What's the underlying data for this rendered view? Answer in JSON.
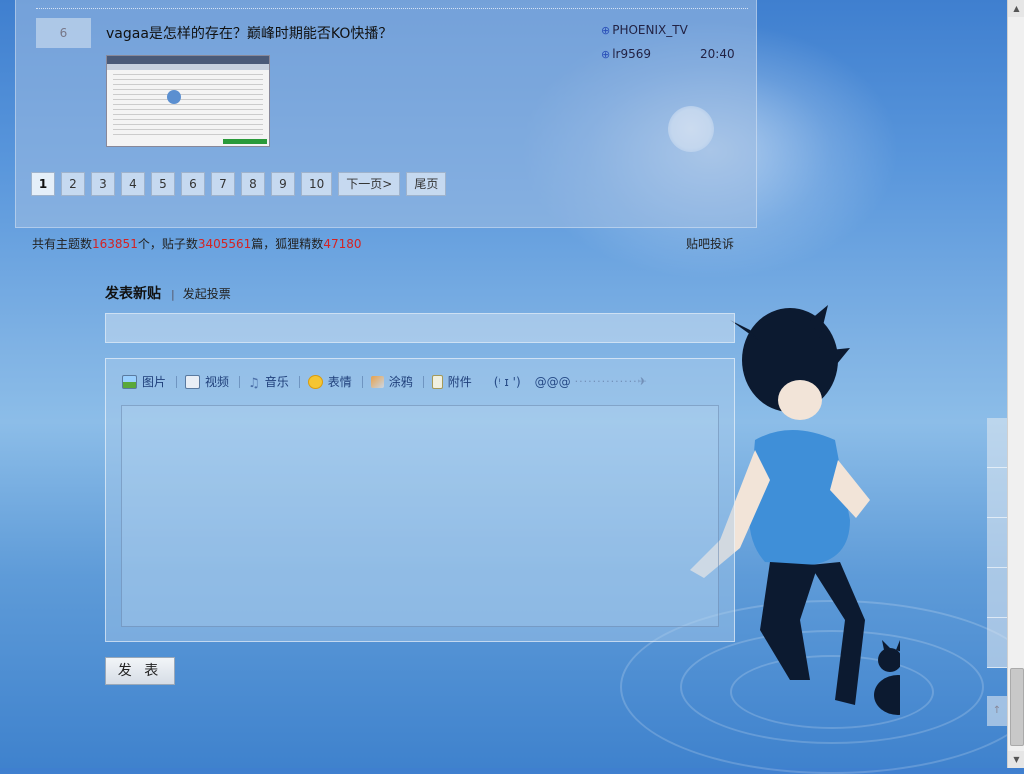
{
  "thread": {
    "reply_count": "6",
    "title": "vagaa是怎样的存在？巅峰时期能否KO快播？",
    "author": "PHOENIX_TV",
    "last_replier": "lr9569",
    "last_time": "20:40",
    "user_icon": "user-plus-icon"
  },
  "pagination": {
    "pages": [
      "1",
      "2",
      "3",
      "4",
      "5",
      "6",
      "7",
      "8",
      "9",
      "10"
    ],
    "current": "1",
    "next_label": "下一页>",
    "last_label": "尾页"
  },
  "stats": {
    "topics_prefix": "共有主题数",
    "topics": "163851",
    "topics_unit": "个，贴子数",
    "posts": "3405561",
    "posts_unit": "篇，狐狸精数",
    "fans": "47180",
    "complain_label": "贴吧投诉"
  },
  "compose": {
    "title": "发表新贴",
    "separator": "|",
    "vote_label": "发起投票",
    "toolbar": {
      "image": "图片",
      "video": "视频",
      "music": "音乐",
      "emoji": "表情",
      "doodle": "涂鸦",
      "attach": "附件",
      "emoticon": "(ᵎ ɪ ')",
      "at": "@@@"
    },
    "submit_label": "发 表"
  },
  "colors": {
    "stat_number": "#d52222",
    "link": "#1f3f7a"
  }
}
